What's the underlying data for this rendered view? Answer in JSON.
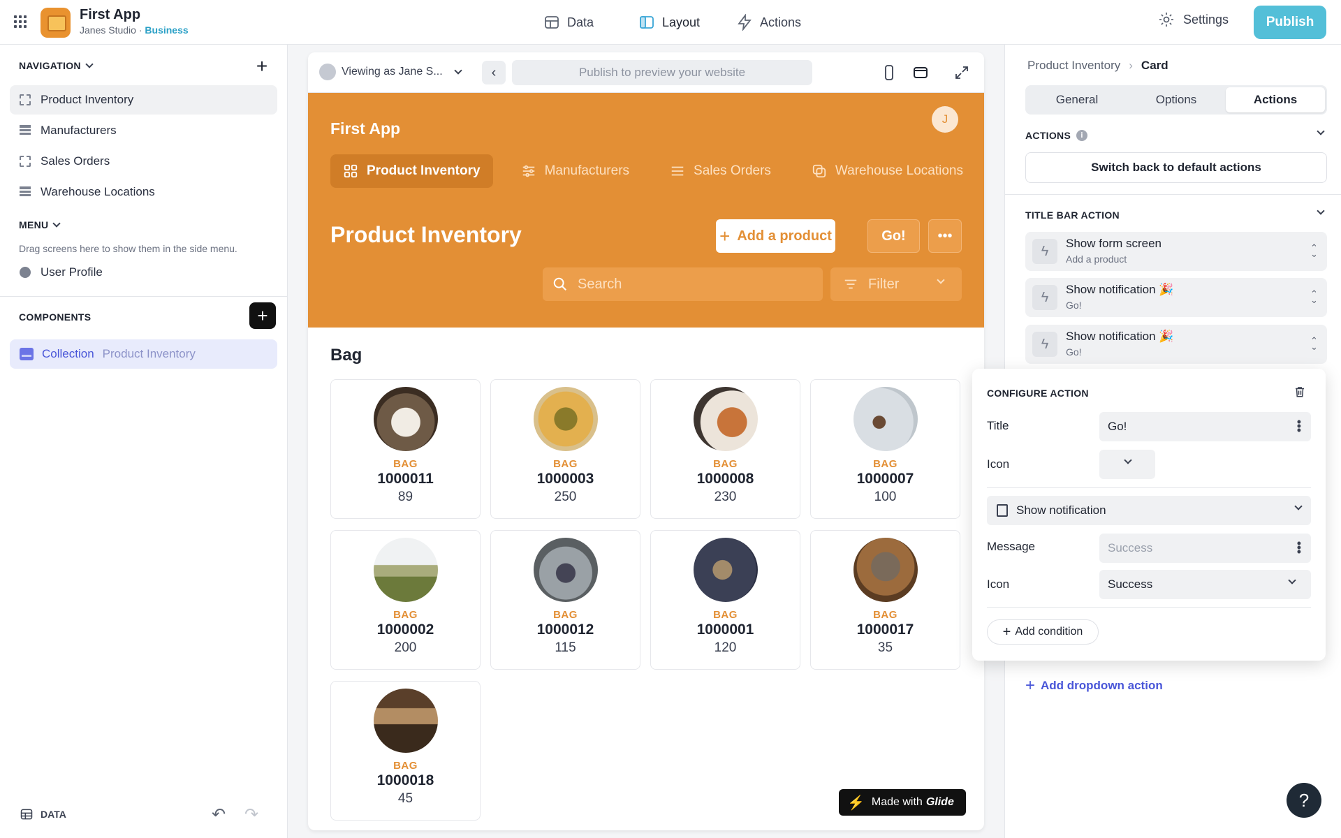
{
  "app": {
    "title": "First App",
    "studio": "Janes Studio",
    "separator": "·",
    "plan": "Business"
  },
  "topnav": {
    "data": "Data",
    "layout": "Layout",
    "actions": "Actions",
    "settings": "Settings",
    "publish": "Publish"
  },
  "left": {
    "navigation_h": "NAVIGATION",
    "nav_items": [
      "Product Inventory",
      "Manufacturers",
      "Sales Orders",
      "Warehouse Locations"
    ],
    "menu_h": "MENU",
    "menu_hint": "Drag screens here to show them in the side menu.",
    "user_profile": "User Profile",
    "components_h": "COMPONENTS",
    "collection_label": "Collection",
    "collection_source": "Product Inventory",
    "data_label": "DATA"
  },
  "preview": {
    "viewing_as": "Viewing as Jane S...",
    "url_placeholder": "Publish to preview your website",
    "app_title": "First App",
    "avatar_initial": "J",
    "tabs": [
      "Product Inventory",
      "Manufacturers",
      "Sales Orders",
      "Warehouse Locations"
    ],
    "screen_title": "Product Inventory",
    "add_button": "Add a product",
    "go_button": "Go!",
    "search_placeholder": "Search",
    "filter_label": "Filter",
    "group_title": "Bag",
    "cards": [
      {
        "category": "BAG",
        "code": "1000011",
        "qty": "89"
      },
      {
        "category": "BAG",
        "code": "1000003",
        "qty": "250"
      },
      {
        "category": "BAG",
        "code": "1000008",
        "qty": "230"
      },
      {
        "category": "BAG",
        "code": "1000007",
        "qty": "100"
      },
      {
        "category": "BAG",
        "code": "1000002",
        "qty": "200"
      },
      {
        "category": "BAG",
        "code": "1000012",
        "qty": "115"
      },
      {
        "category": "BAG",
        "code": "1000001",
        "qty": "120"
      },
      {
        "category": "BAG",
        "code": "1000017",
        "qty": "35"
      },
      {
        "category": "BAG",
        "code": "1000018",
        "qty": "45"
      }
    ],
    "made_with": "Made with",
    "glide": "Glide"
  },
  "right": {
    "crumb_parent": "Product Inventory",
    "crumb_current": "Card",
    "segments": [
      "General",
      "Options",
      "Actions"
    ],
    "actions_h": "ACTIONS",
    "switch_default": "Switch back to default actions",
    "title_bar_h": "TITLE BAR ACTION",
    "action_rows": [
      {
        "title": "Show form screen",
        "sub": "Add a product"
      },
      {
        "title": "Show notification 🎉",
        "sub": "Go!"
      },
      {
        "title": "Show notification 🎉",
        "sub": "Go!"
      }
    ],
    "add_dropdown": "Add dropdown action"
  },
  "config": {
    "heading": "CONFIGURE ACTION",
    "title_label": "Title",
    "title_value": "Go!",
    "icon_label": "Icon",
    "action_type": "Show notification",
    "message_label": "Message",
    "message_placeholder": "Success",
    "icon2_label": "Icon",
    "icon2_value": "Success",
    "add_condition": "Add condition"
  },
  "colors": {
    "accent_orange": "#e38f35",
    "publish": "#53bfd8",
    "link": "#4956d8"
  }
}
